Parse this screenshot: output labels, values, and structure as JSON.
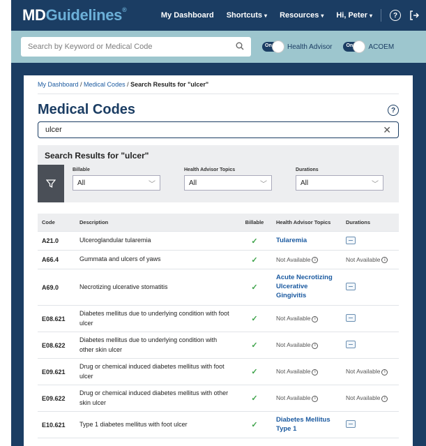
{
  "brand": {
    "md": "MD",
    "guidelines": "Guidelines",
    "reg": "®"
  },
  "nav": {
    "dashboard": "My Dashboard",
    "shortcuts": "Shortcuts",
    "resources": "Resources",
    "user": "Hi, Peter"
  },
  "search": {
    "placeholder": "Search by Keyword or Medical Code",
    "toggle_on": "On",
    "health_advisor": "Health Advisor",
    "acoem": "ACOEM"
  },
  "breadcrumb": {
    "dashboard": "My Dashboard",
    "sep": " / ",
    "medical_codes": "Medical Codes",
    "current": "Search Results for \"ulcer\""
  },
  "page": {
    "title": "Medical Codes",
    "query": "ulcer"
  },
  "results": {
    "title": "Search Results for \"ulcer\"",
    "filters": {
      "billable_label": "Billable",
      "billable_value": "All",
      "topics_label": "Health Advisor Topics",
      "topics_value": "All",
      "durations_label": "Durations",
      "durations_value": "All"
    }
  },
  "table": {
    "headers": {
      "code": "Code",
      "description": "Description",
      "billable": "Billable",
      "topics": "Health Advisor Topics",
      "durations": "Durations"
    },
    "rows": [
      {
        "code": "A21.0",
        "description": "Ulceroglandular tularemia",
        "topic": "Tularemia",
        "duration": "icon"
      },
      {
        "code": "A66.4",
        "description": "Gummata and ulcers of yaws",
        "topic": "Not Available",
        "duration": "Not Available"
      },
      {
        "code": "A69.0",
        "description": "Necrotizing ulcerative stomatitis",
        "topic": "Acute Necrotizing Ulcerative Gingivitis",
        "duration": "icon"
      },
      {
        "code": "E08.621",
        "description": "Diabetes mellitus due to underlying condition with foot ulcer",
        "topic": "Not Available",
        "duration": "icon"
      },
      {
        "code": "E08.622",
        "description": "Diabetes mellitus due to underlying condition with other skin ulcer",
        "topic": "Not Available",
        "duration": "icon"
      },
      {
        "code": "E09.621",
        "description": "Drug or chemical induced diabetes mellitus with foot ulcer",
        "topic": "Not Available",
        "duration": "Not Available"
      },
      {
        "code": "E09.622",
        "description": "Drug or chemical induced diabetes mellitus with other skin ulcer",
        "topic": "Not Available",
        "duration": "Not Available"
      },
      {
        "code": "E10.621",
        "description": "Type 1 diabetes mellitus with foot ulcer",
        "topic": "Diabetes Mellitus Type 1",
        "duration": "icon"
      }
    ]
  }
}
